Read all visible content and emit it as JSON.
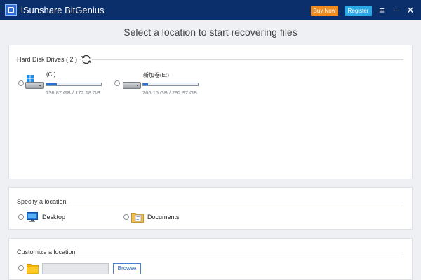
{
  "window": {
    "app_title": "iSunshare BitGenius",
    "buy_now_label": "Buy Now",
    "register_label": "Register"
  },
  "header": {
    "instruction": "Select a location to start recovering files"
  },
  "hard_disk": {
    "section_title": "Hard Disk Drives ( 2 )",
    "drives": [
      {
        "label": "(C:)",
        "size_text": "136.87 GB / 172.18 GB",
        "used_fraction": 0.19
      },
      {
        "label": "新加卷(E:)",
        "size_text": "266.15 GB / 292.97 GB",
        "used_fraction": 0.09
      }
    ]
  },
  "specify_location": {
    "section_title": "Specify a location",
    "desktop_label": "Desktop",
    "documents_label": "Documents"
  },
  "customize_location": {
    "section_title": "Customize a location",
    "path_value": "",
    "browse_label": "Browse"
  },
  "colors": {
    "titlebar": "#0b2f6b",
    "buy_button": "#f08a1c",
    "register_button": "#2aa9e6",
    "progress_fill": "#2a6fd6"
  }
}
